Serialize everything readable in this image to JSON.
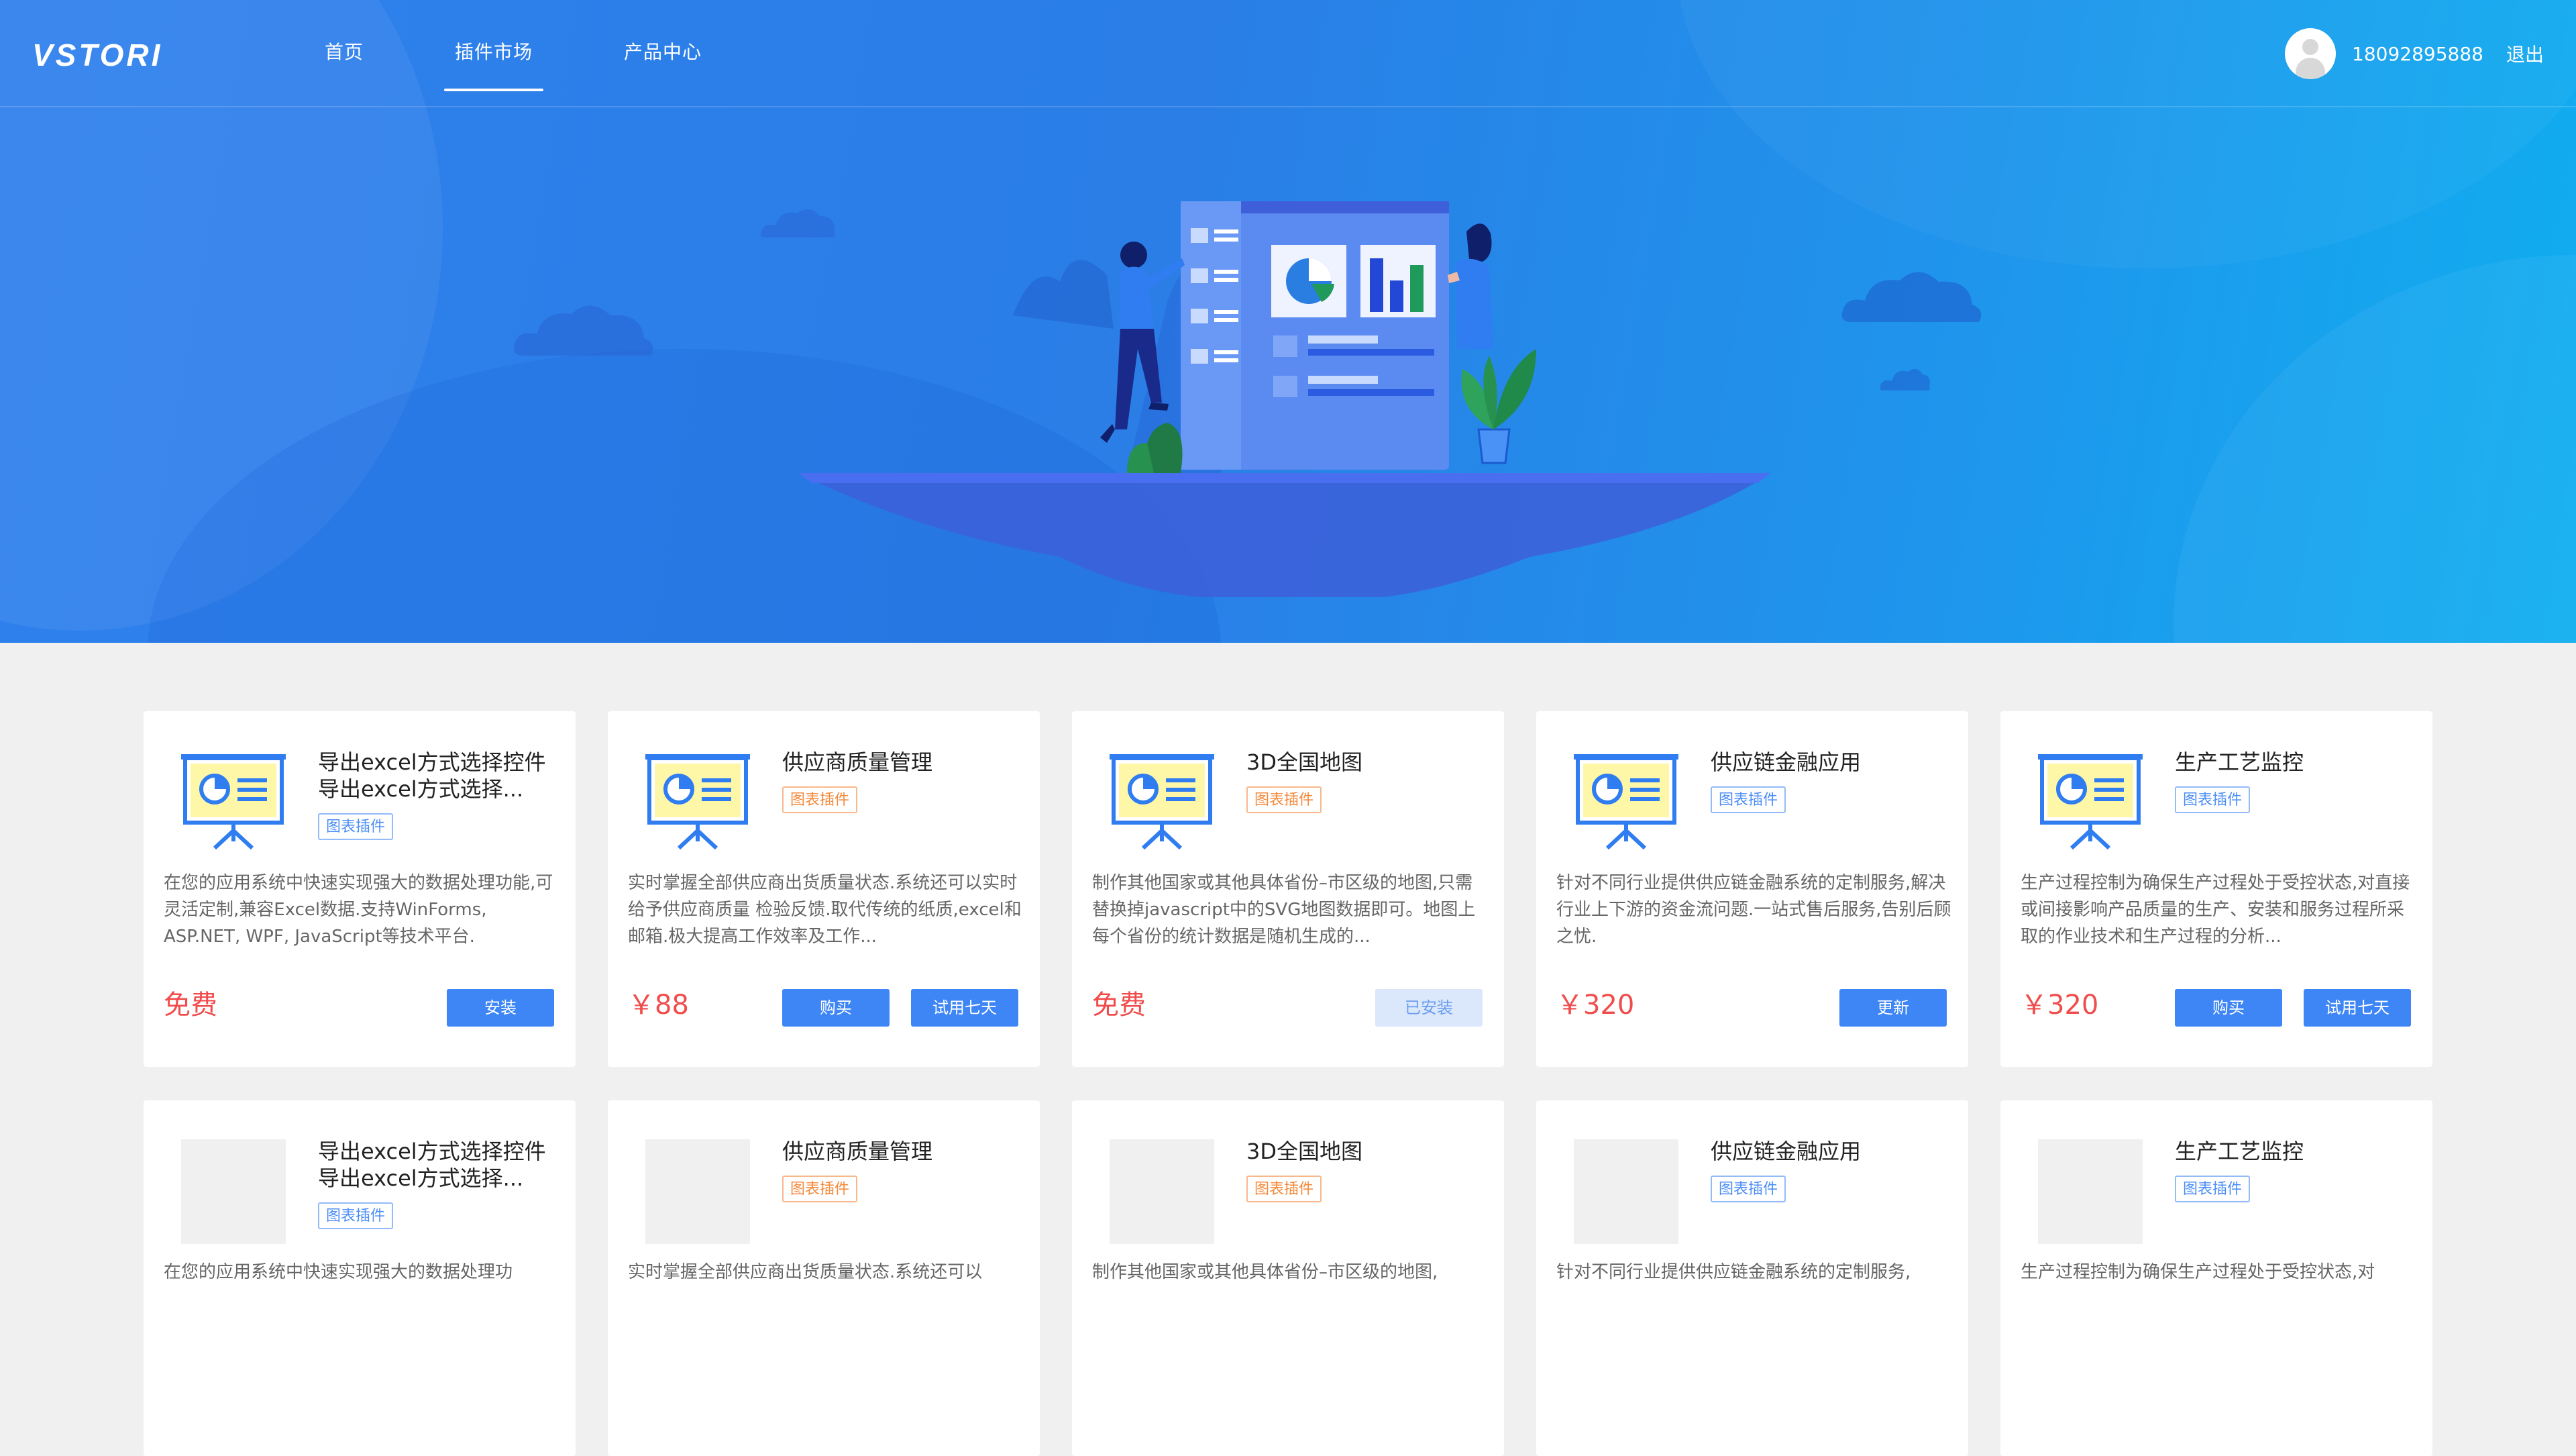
{
  "brand": {
    "logo_text": "VSTORI"
  },
  "nav": {
    "items": [
      {
        "label": "首页"
      },
      {
        "label": "插件市场",
        "active": true
      },
      {
        "label": "产品中心"
      }
    ],
    "user": {
      "phone": "18092895888",
      "logout_label": "退出"
    }
  },
  "colors": {
    "accent": "#3e86f5",
    "price": "#f14c4c",
    "tag_blue": "#4c8ef7",
    "tag_orange": "#f58a3b"
  },
  "cards": [
    {
      "title": "导出excel方式选择控件导出excel方式选择...",
      "tag": "图表插件",
      "tag_color": "blue",
      "desc": "在您的应用系统中快速实现强大的数据处理功能,可灵活定制,兼容Excel数据.支持WinForms, ASP.NET, WPF, JavaScript等技术平台.",
      "price": "免费",
      "buttons": [
        "安装"
      ]
    },
    {
      "title": "供应商质量管理",
      "tag": "图表插件",
      "tag_color": "orange",
      "desc": "实时掌握全部供应商出货质量状态.系统还可以实时给予供应商质量 检验反馈.取代传统的纸质,excel和邮箱.极大提高工作效率及工作...",
      "price": "￥88",
      "buttons": [
        "购买",
        "试用七天"
      ]
    },
    {
      "title": "3D全国地图",
      "tag": "图表插件",
      "tag_color": "orange",
      "desc": "制作其他国家或其他具体省份–市区级的地图,只需替换掉javascript中的SVG地图数据即可。地图上每个省份的统计数据是随机生成的...",
      "price": "免费",
      "buttons": [
        "已安装"
      ]
    },
    {
      "title": "供应链金融应用",
      "tag": "图表插件",
      "tag_color": "blue",
      "desc": "针对不同行业提供供应链金融系统的定制服务,解决行业上下游的资金流问题.一站式售后服务,告别后顾之忧.",
      "price": "￥320",
      "buttons": [
        "更新"
      ]
    },
    {
      "title": "生产工艺监控",
      "tag": "图表插件",
      "tag_color": "blue",
      "desc": "生产过程控制为确保生产过程处于受控状态,对直接或间接影响产品质量的生产、安装和服务过程所采取的作业技术和生产过程的分析...",
      "price": "￥320",
      "buttons": [
        "购买",
        "试用七天"
      ]
    },
    {
      "title": "导出excel方式选择控件导出excel方式选择...",
      "tag": "图表插件",
      "tag_color": "blue",
      "desc": "在您的应用系统中快速实现强大的数据处理功"
    },
    {
      "title": "供应商质量管理",
      "tag": "图表插件",
      "tag_color": "orange",
      "desc": "实时掌握全部供应商出货质量状态.系统还可以"
    },
    {
      "title": "3D全国地图",
      "tag": "图表插件",
      "tag_color": "orange",
      "desc": "制作其他国家或其他具体省份–市区级的地图,"
    },
    {
      "title": "供应链金融应用",
      "tag": "图表插件",
      "tag_color": "blue",
      "desc": "针对不同行业提供供应链金融系统的定制服务,"
    },
    {
      "title": "生产工艺监控",
      "tag": "图表插件",
      "tag_color": "blue",
      "desc": "生产过程控制为确保生产过程处于受控状态,对"
    }
  ]
}
